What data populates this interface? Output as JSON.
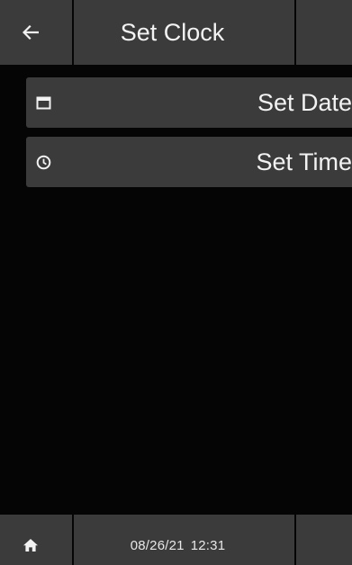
{
  "header": {
    "back_icon": "arrow-left-icon",
    "title": "Set Clock"
  },
  "menu": {
    "items": [
      {
        "icon": "calendar-icon",
        "label": "Set Date"
      },
      {
        "icon": "clock-icon",
        "label": "Set Time"
      }
    ]
  },
  "footer": {
    "home_icon": "home-icon",
    "date": "08/26/21",
    "time": "12:31"
  },
  "colors": {
    "background": "#050505",
    "panel": "#3b3b3b",
    "text": "#f2f2f2"
  }
}
